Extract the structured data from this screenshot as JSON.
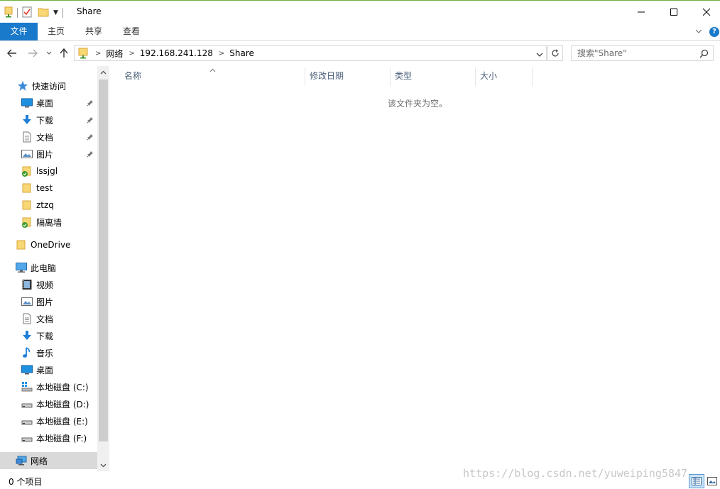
{
  "window": {
    "title": "Share",
    "controls": {
      "minimize": "minimize",
      "maximize": "maximize",
      "close": "close"
    }
  },
  "ribbon": {
    "tabs": [
      {
        "label": "文件",
        "active": true
      },
      {
        "label": "主页"
      },
      {
        "label": "共享"
      },
      {
        "label": "查看"
      }
    ],
    "help": "?"
  },
  "address": {
    "breadcrumb": [
      "网络",
      "192.168.241.128",
      "Share"
    ]
  },
  "search": {
    "placeholder": "搜索\"Share\""
  },
  "nav_pane": {
    "items": [
      {
        "label": "快速访问",
        "icon": "star-icon"
      },
      {
        "label": "桌面",
        "icon": "desktop-icon",
        "pinned": true
      },
      {
        "label": "下载",
        "icon": "download-icon",
        "pinned": true
      },
      {
        "label": "文档",
        "icon": "document-icon",
        "pinned": true
      },
      {
        "label": "图片",
        "icon": "picture-icon",
        "pinned": true
      },
      {
        "label": "lssjgl",
        "icon": "folder-sync-icon"
      },
      {
        "label": "test",
        "icon": "folder-icon"
      },
      {
        "label": "ztzq",
        "icon": "folder-icon"
      },
      {
        "label": "隔离墙",
        "icon": "folder-sync-icon"
      },
      {
        "label": "OneDrive",
        "icon": "folder-icon"
      },
      {
        "label": "此电脑",
        "icon": "computer-icon"
      },
      {
        "label": "视频",
        "icon": "video-icon"
      },
      {
        "label": "图片",
        "icon": "picture-icon"
      },
      {
        "label": "文档",
        "icon": "document-icon"
      },
      {
        "label": "下载",
        "icon": "download-icon"
      },
      {
        "label": "音乐",
        "icon": "music-icon"
      },
      {
        "label": "桌面",
        "icon": "desktop-icon"
      },
      {
        "label": "本地磁盘 (C:)",
        "icon": "system-drive-icon"
      },
      {
        "label": "本地磁盘 (D:)",
        "icon": "drive-icon"
      },
      {
        "label": "本地磁盘 (E:)",
        "icon": "drive-icon"
      },
      {
        "label": "本地磁盘 (F:)",
        "icon": "drive-icon"
      },
      {
        "label": "网络",
        "icon": "network-icon",
        "selected": true
      }
    ]
  },
  "file_list": {
    "columns": [
      "名称",
      "修改日期",
      "类型",
      "大小"
    ],
    "empty_message": "该文件夹为空。"
  },
  "status_bar": {
    "item_count": "0 个项目",
    "watermark": "https://blog.csdn.net/yuweiping5847"
  },
  "colors": {
    "accent": "#1979ca",
    "folder": "#f8d775",
    "selected_bg": "#d9d9d9"
  }
}
